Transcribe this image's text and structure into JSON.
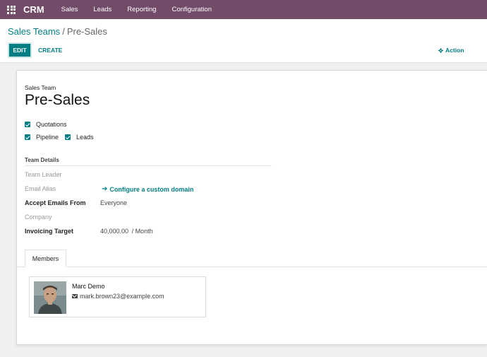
{
  "topbar": {
    "brand": "CRM",
    "menu": [
      "Sales",
      "Leads",
      "Reporting",
      "Configuration"
    ]
  },
  "breadcrumb": {
    "parent": "Sales Teams",
    "separator": "/",
    "current": "Pre-Sales"
  },
  "controls": {
    "edit_label": "EDIT",
    "create_label": "CREATE",
    "action_label": "Action"
  },
  "form": {
    "name_label": "Sales Team",
    "name": "Pre-Sales",
    "checkboxes": {
      "quotations": "Quotations",
      "pipeline": "Pipeline",
      "leads": "Leads"
    },
    "section_title": "Team Details",
    "fields": {
      "team_leader": "Team Leader",
      "email_alias": "Email Alias",
      "email_alias_link": "Configure a custom domain",
      "accept_emails_from": "Accept Emails From",
      "accept_emails_value": "Everyone",
      "company": "Company",
      "invoicing_target": "Invoicing Target",
      "invoicing_target_value": "40,000.00",
      "invoicing_target_unit": "/ Month"
    }
  },
  "tabs": {
    "members": "Members"
  },
  "members": [
    {
      "name": "Marc Demo",
      "email": "mark.brown23@example.com"
    }
  ],
  "colors": {
    "topbar": "#714b67",
    "primary": "#017e84"
  }
}
